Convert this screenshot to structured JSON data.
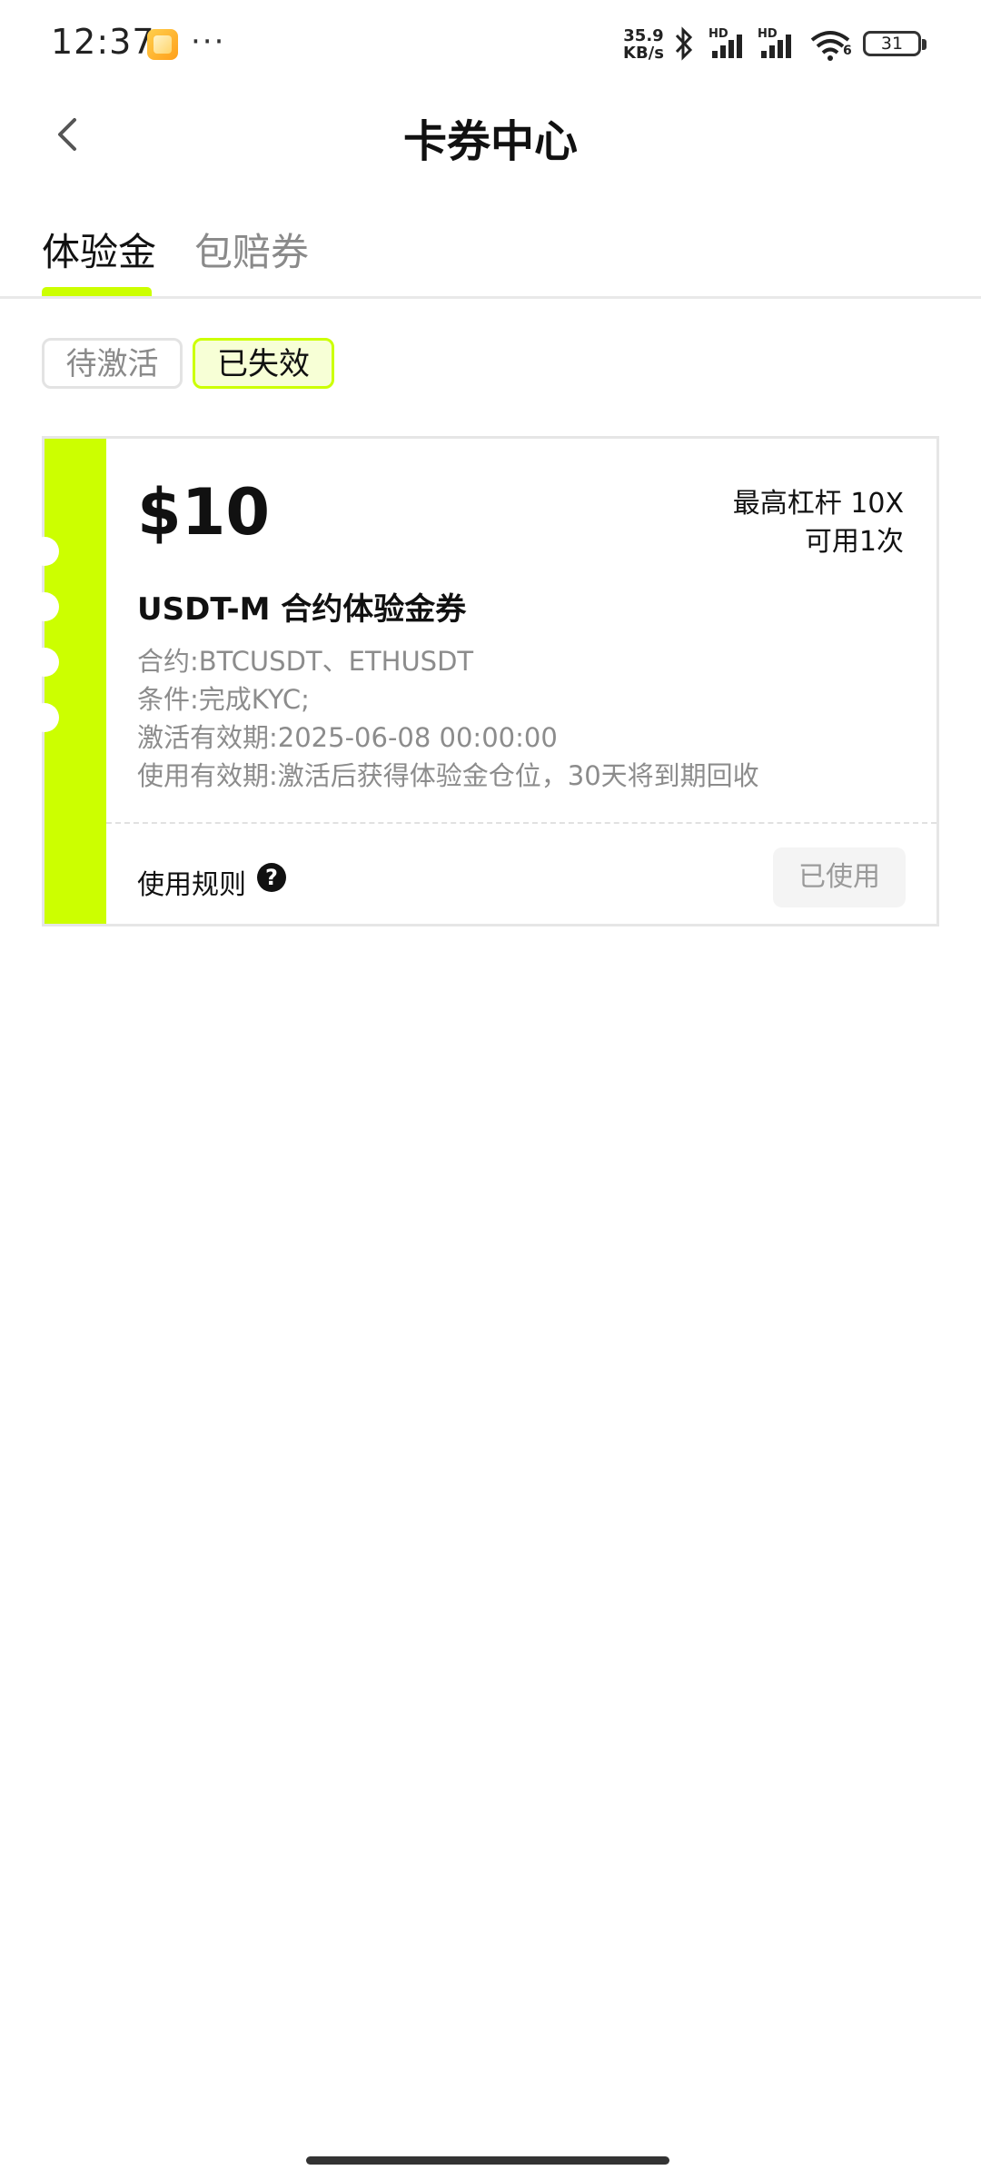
{
  "status_bar": {
    "time": "12:37",
    "more": "···",
    "net_speed_value": "35.9",
    "net_speed_unit": "KB/s",
    "sim1_label": "HD",
    "sim2_label": "HD",
    "wifi_label": "6",
    "battery": "31"
  },
  "header": {
    "title": "卡券中心"
  },
  "tabs": [
    {
      "label": "体验金",
      "active": true
    },
    {
      "label": "包赔券",
      "active": false
    }
  ],
  "filters": [
    {
      "label": "待激活",
      "selected": false
    },
    {
      "label": "已失效",
      "selected": true
    }
  ],
  "coupon": {
    "amount": "$10",
    "max_leverage": "最高杠杆 10X",
    "usable_times": "可用1次",
    "name": "USDT-M 合约体验金券",
    "details": [
      "合约:BTCUSDT、ETHUSDT",
      "条件:完成KYC;",
      "激活有效期:2025-06-08 00:00:00",
      "使用有效期:激活后获得体验金仓位，30天将到期回收"
    ],
    "rules_label": "使用规则",
    "help_glyph": "?",
    "status_button": "已使用"
  },
  "colors": {
    "accent": "#ccff00",
    "text": "#111111",
    "muted": "#8c8c8c"
  }
}
